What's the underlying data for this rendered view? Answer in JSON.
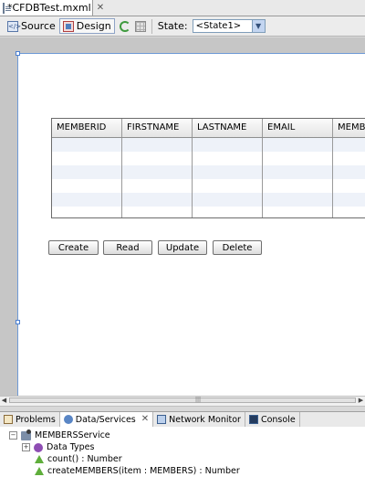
{
  "editor": {
    "tab_title": "*CFDBTest.mxml"
  },
  "toolbar": {
    "source_label": "Source",
    "design_label": "Design",
    "state_label": "State:",
    "state_value": "<State1>"
  },
  "datagrid": {
    "columns": [
      "MEMBERID",
      "FIRSTNAME",
      "LASTNAME",
      "EMAIL",
      "MEMBE"
    ]
  },
  "buttons": {
    "create": "Create",
    "read": "Read",
    "update": "Update",
    "delete": "Delete"
  },
  "panel": {
    "tabs": {
      "problems": "Problems",
      "data_services": "Data/Services",
      "network_monitor": "Network Monitor",
      "console": "Console"
    },
    "tree": {
      "service": "MEMBERSService",
      "data_types": "Data Types",
      "op1": "count() : Number",
      "op2": "createMEMBERS(item : MEMBERS) : Number"
    }
  }
}
